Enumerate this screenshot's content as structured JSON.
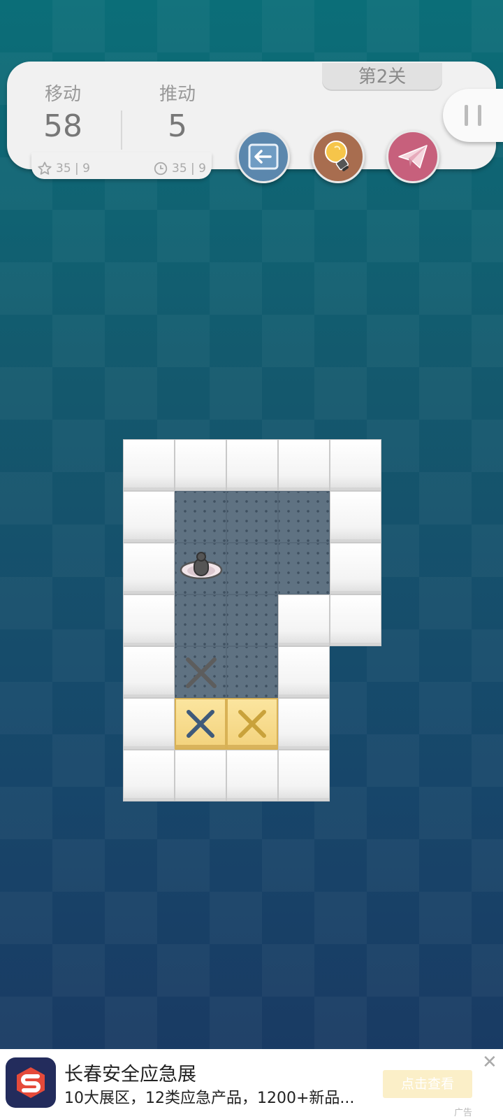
{
  "header": {
    "level_label": "第2关",
    "moves": {
      "label": "移动",
      "value": "58",
      "best": "35 | 9"
    },
    "pushes": {
      "label": "推动",
      "value": "5",
      "best": "35 | 9"
    }
  },
  "buttons": {
    "undo": {
      "icon": "undo-arrow-icon",
      "color": "#5b87ad"
    },
    "hint": {
      "icon": "lightbulb-icon",
      "color": "#a86d4f"
    },
    "share": {
      "icon": "paper-plane-icon",
      "color": "#c7607c"
    },
    "pause": {
      "icon": "pause-icon"
    }
  },
  "board": {
    "rows": [
      "#####",
      "#...#",
      "#@..#",
      "#..##",
      "#x.# ",
      "#BB# ",
      "#### "
    ],
    "legend": {
      "#": "wall",
      ".": "floor",
      "@": "player",
      "x": "target",
      "B": "crate-on-target"
    },
    "crate_colors": [
      "#3f5a7a",
      "#c9a23b"
    ]
  },
  "ad": {
    "title": "长春安全应急展",
    "description": "10大展区，12类应急产品，1200+新品...",
    "cta": "点击查看",
    "tag": "广告",
    "close": "✕"
  }
}
